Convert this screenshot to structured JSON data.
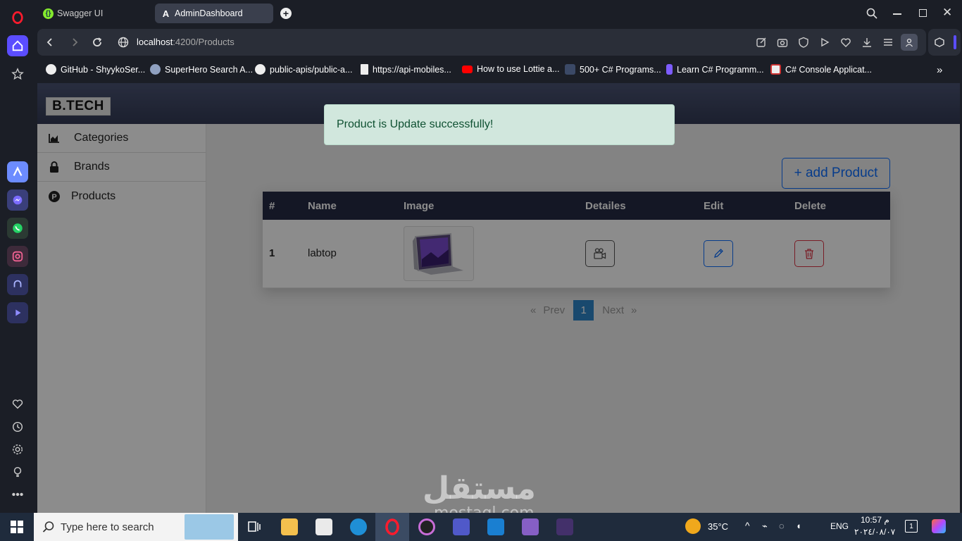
{
  "browser": {
    "tabs": [
      {
        "label": "Swagger UI",
        "active": false
      },
      {
        "label": "AdminDashboard",
        "active": true
      }
    ],
    "new_tab": "+",
    "url": {
      "host": "localhost",
      "path": ":4200/Products"
    }
  },
  "bookmarks": [
    {
      "label": "GitHub - ShyykoSer...",
      "icon": "github-icon"
    },
    {
      "label": "SuperHero Search A...",
      "icon": "superhero-icon"
    },
    {
      "label": "public-apis/public-a...",
      "icon": "github-icon"
    },
    {
      "label": "https://api-mobiles...",
      "icon": "document-icon"
    },
    {
      "label": "How to use Lottie a...",
      "icon": "youtube-icon"
    },
    {
      "label": "500+ C# Programs...",
      "icon": "csharp-icon"
    },
    {
      "label": "Learn C# Programm...",
      "icon": "learn-icon"
    },
    {
      "label": "C# Console Applicat...",
      "icon": "console-icon"
    }
  ],
  "app": {
    "logo": "B.TECH",
    "sidebar": [
      {
        "label": "Categories",
        "icon": "chart-icon"
      },
      {
        "label": "Brands",
        "icon": "lock-icon"
      },
      {
        "label": "Products",
        "icon": "p-circle-icon"
      }
    ],
    "add_button": "+ add Product",
    "table": {
      "headers": [
        "#",
        "Name",
        "Image",
        "Detailes",
        "Edit",
        "Delete"
      ],
      "rows": [
        {
          "index": "1",
          "name": "labtop"
        }
      ]
    },
    "pager": {
      "first": "«",
      "prev": "Prev",
      "current": "1",
      "next": "Next",
      "last": "»"
    },
    "toast": "Product is Update successfully!"
  },
  "watermark": {
    "arabic": "مستقل",
    "latin": "mostaql.com"
  },
  "taskbar": {
    "search_placeholder": "Type here to search",
    "weather": "35°C",
    "lang": "ENG",
    "time": "10:57 م",
    "date": "٢٠٢٤/٠٨/٠٧",
    "notif_count": "1"
  },
  "colors": {
    "primary": "#0d6efd",
    "danger": "#dc3545",
    "header_dark": "#252a44",
    "toast_bg": "#d1e7dd"
  }
}
